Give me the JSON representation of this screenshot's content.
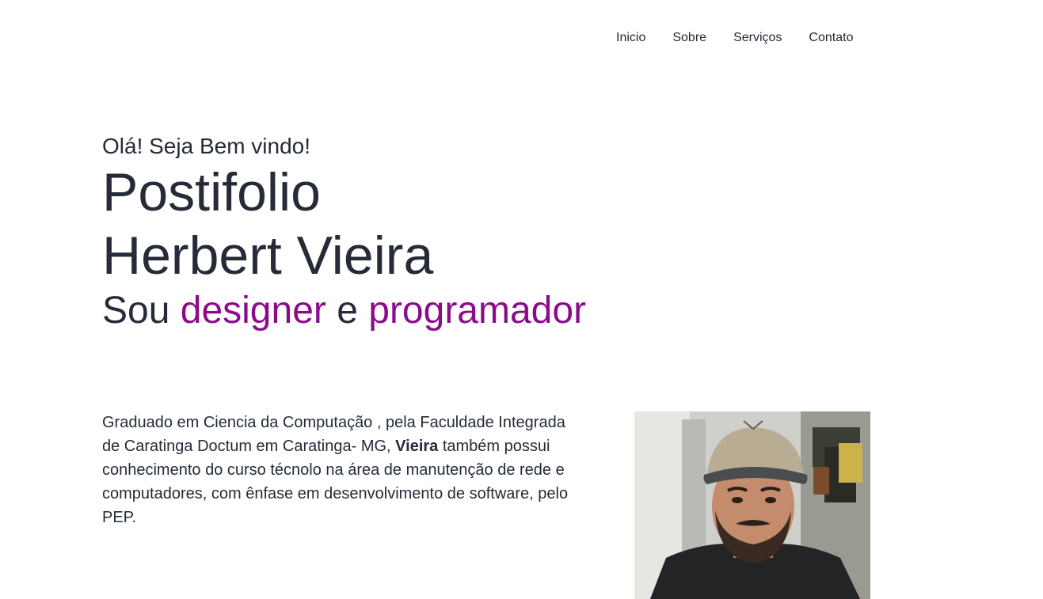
{
  "nav": {
    "items": [
      {
        "label": "Inicio"
      },
      {
        "label": "Sobre"
      },
      {
        "label": "Serviços"
      },
      {
        "label": "Contato"
      }
    ]
  },
  "hero": {
    "greeting": "Olá! Seja Bem vindo!",
    "title_line1": "Postifolio",
    "title_line2": "Herbert Vieira",
    "subtitle": {
      "prefix": "Sou ",
      "word1": "designer",
      "middle": " e ",
      "word2": "programador"
    },
    "accent_color": "#8b0c8b"
  },
  "about": {
    "text_before": "Graduado em Ciencia da Computação , pela Faculdade Integrada de Caratinga Doctum em Caratinga- MG, ",
    "bold_name": "Vieira",
    "text_after": " também possui conhecimento do curso técnolo na área de manutenção de rede e computadores, com ênfase em desenvolvimento de software, pelo PEP."
  }
}
